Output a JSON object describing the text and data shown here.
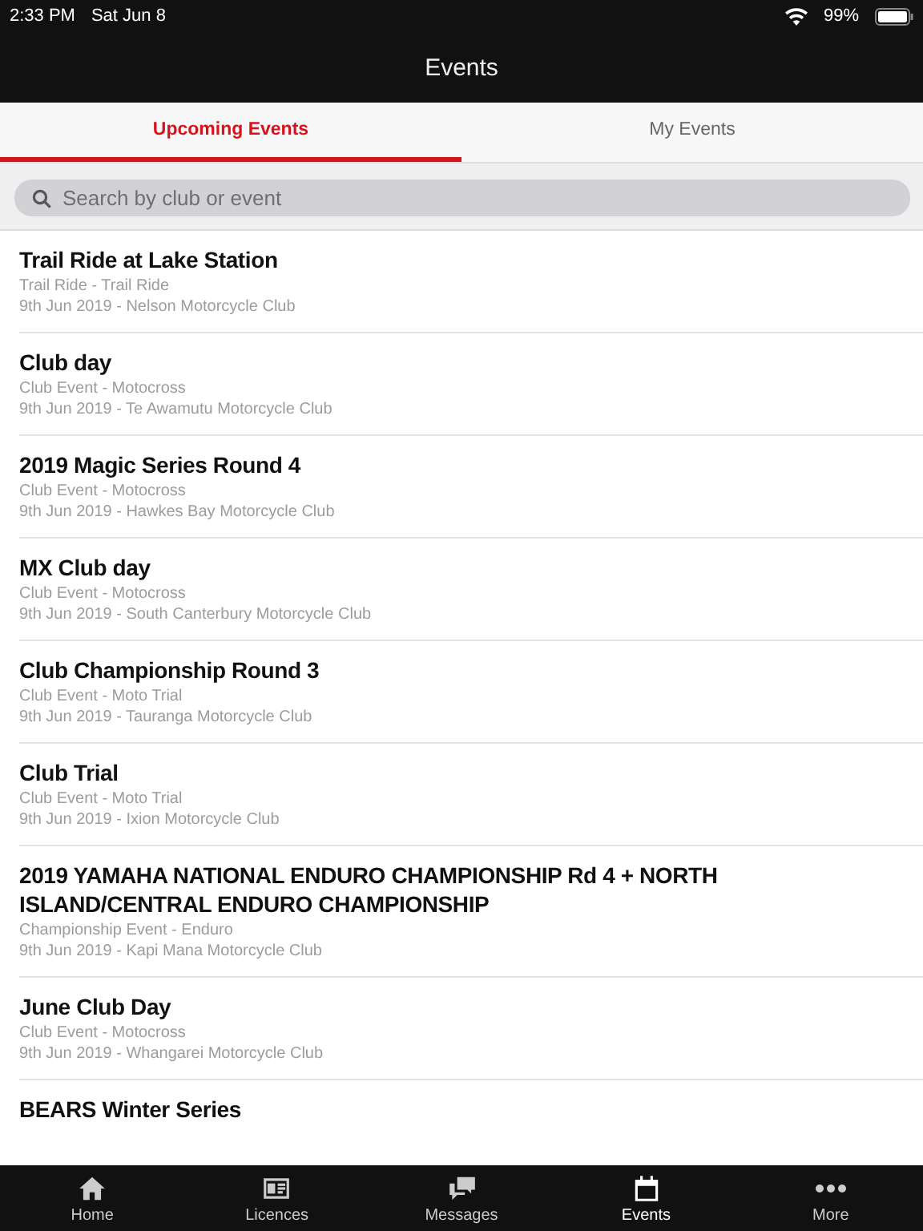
{
  "status_bar": {
    "time": "2:33 PM",
    "date": "Sat Jun 8",
    "battery": "99%"
  },
  "header": {
    "title": "Events"
  },
  "tabs": [
    {
      "label": "Upcoming Events",
      "selected": true
    },
    {
      "label": "My Events",
      "selected": false
    }
  ],
  "search": {
    "placeholder": "Search by club or event"
  },
  "events": [
    {
      "title": "Trail Ride at Lake Station",
      "category": "Trail Ride - Trail Ride",
      "details": "9th Jun 2019 - Nelson Motorcycle Club"
    },
    {
      "title": "Club day",
      "category": "Club Event - Motocross",
      "details": "9th Jun 2019 - Te Awamutu Motorcycle Club"
    },
    {
      "title": "2019 Magic Series Round 4",
      "category": "Club Event - Motocross",
      "details": "9th Jun 2019 - Hawkes Bay Motorcycle Club"
    },
    {
      "title": "MX Club day",
      "category": "Club Event - Motocross",
      "details": "9th Jun 2019 - South Canterbury Motorcycle Club"
    },
    {
      "title": "Club Championship Round 3",
      "category": "Club Event - Moto Trial",
      "details": "9th Jun 2019 - Tauranga Motorcycle Club"
    },
    {
      "title": "Club Trial",
      "category": "Club Event - Moto Trial",
      "details": "9th Jun 2019 - Ixion Motorcycle Club"
    },
    {
      "title": "2019 YAMAHA NATIONAL ENDURO CHAMPIONSHIP Rd 4 + NORTH ISLAND/CENTRAL ENDURO CHAMPIONSHIP",
      "category": "Championship Event - Enduro",
      "details": "9th Jun 2019 - Kapi Mana Motorcycle Club"
    },
    {
      "title": "June Club Day",
      "category": "Club Event - Motocross",
      "details": "9th Jun 2019 - Whangarei Motorcycle Club"
    },
    {
      "title": "BEARS Winter Series"
    }
  ],
  "tab_bar": [
    {
      "kind": "home",
      "label": "Home",
      "selected": false
    },
    {
      "kind": "licences",
      "label": "Licences",
      "selected": false
    },
    {
      "kind": "messages",
      "label": "Messages",
      "selected": false
    },
    {
      "kind": "events",
      "label": "Events",
      "selected": true
    },
    {
      "kind": "more",
      "label": "More",
      "selected": false
    }
  ]
}
